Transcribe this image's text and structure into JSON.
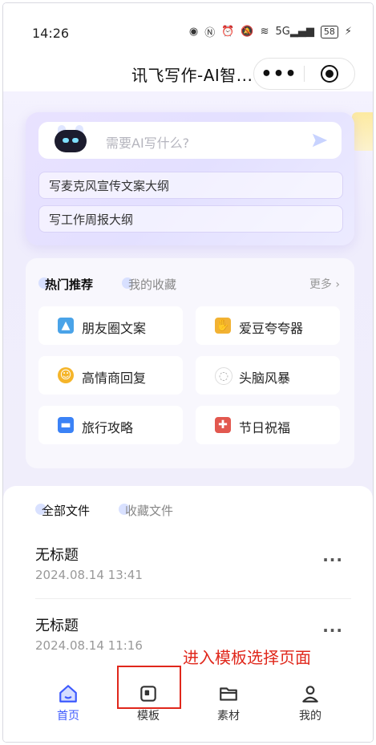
{
  "status_bar": {
    "time": "14:26",
    "battery": "58",
    "signal": "5G"
  },
  "nav": {
    "title": "讯飞写作-AI智...",
    "more_icon": "more-dots-icon",
    "close_icon": "target-close-icon"
  },
  "ai_card": {
    "placeholder": "需要AI写什么?",
    "prompts": [
      "写麦克风宣传文案大纲",
      "写工作周报大纲"
    ]
  },
  "recommend": {
    "tabs": [
      "热门推荐",
      "我的收藏"
    ],
    "more": "更多 ›",
    "items": [
      {
        "label": "朋友圈文案",
        "icon": "landscape-icon",
        "color": "#4aa3e8"
      },
      {
        "label": "爱豆夸夸器",
        "icon": "hand-gesture-icon",
        "color": "#f2b233"
      },
      {
        "label": "高情商回复",
        "icon": "smile-face-icon",
        "color": "#f5b52a"
      },
      {
        "label": "头脑风暴",
        "icon": "thought-bubble-icon",
        "color": "#cfcfd6"
      },
      {
        "label": "旅行攻略",
        "icon": "car-icon",
        "color": "#3b82f6"
      },
      {
        "label": "节日祝福",
        "icon": "gift-icon",
        "color": "#e2584f"
      }
    ]
  },
  "files": {
    "tabs": [
      "全部文件",
      "收藏文件"
    ],
    "items": [
      {
        "name": "无标题",
        "date": "2024.08.14 13:41"
      },
      {
        "name": "无标题",
        "date": "2024.08.14 11:16"
      }
    ]
  },
  "annotation": "进入模板选择页面",
  "tabbar": [
    {
      "label": "首页",
      "icon": "home-icon",
      "active": true
    },
    {
      "label": "模板",
      "icon": "template-icon",
      "active": false
    },
    {
      "label": "素材",
      "icon": "folder-icon",
      "active": false
    },
    {
      "label": "我的",
      "icon": "user-icon",
      "active": false
    }
  ],
  "colors": {
    "accent": "#3d5afe",
    "annotation": "#e0271b"
  }
}
